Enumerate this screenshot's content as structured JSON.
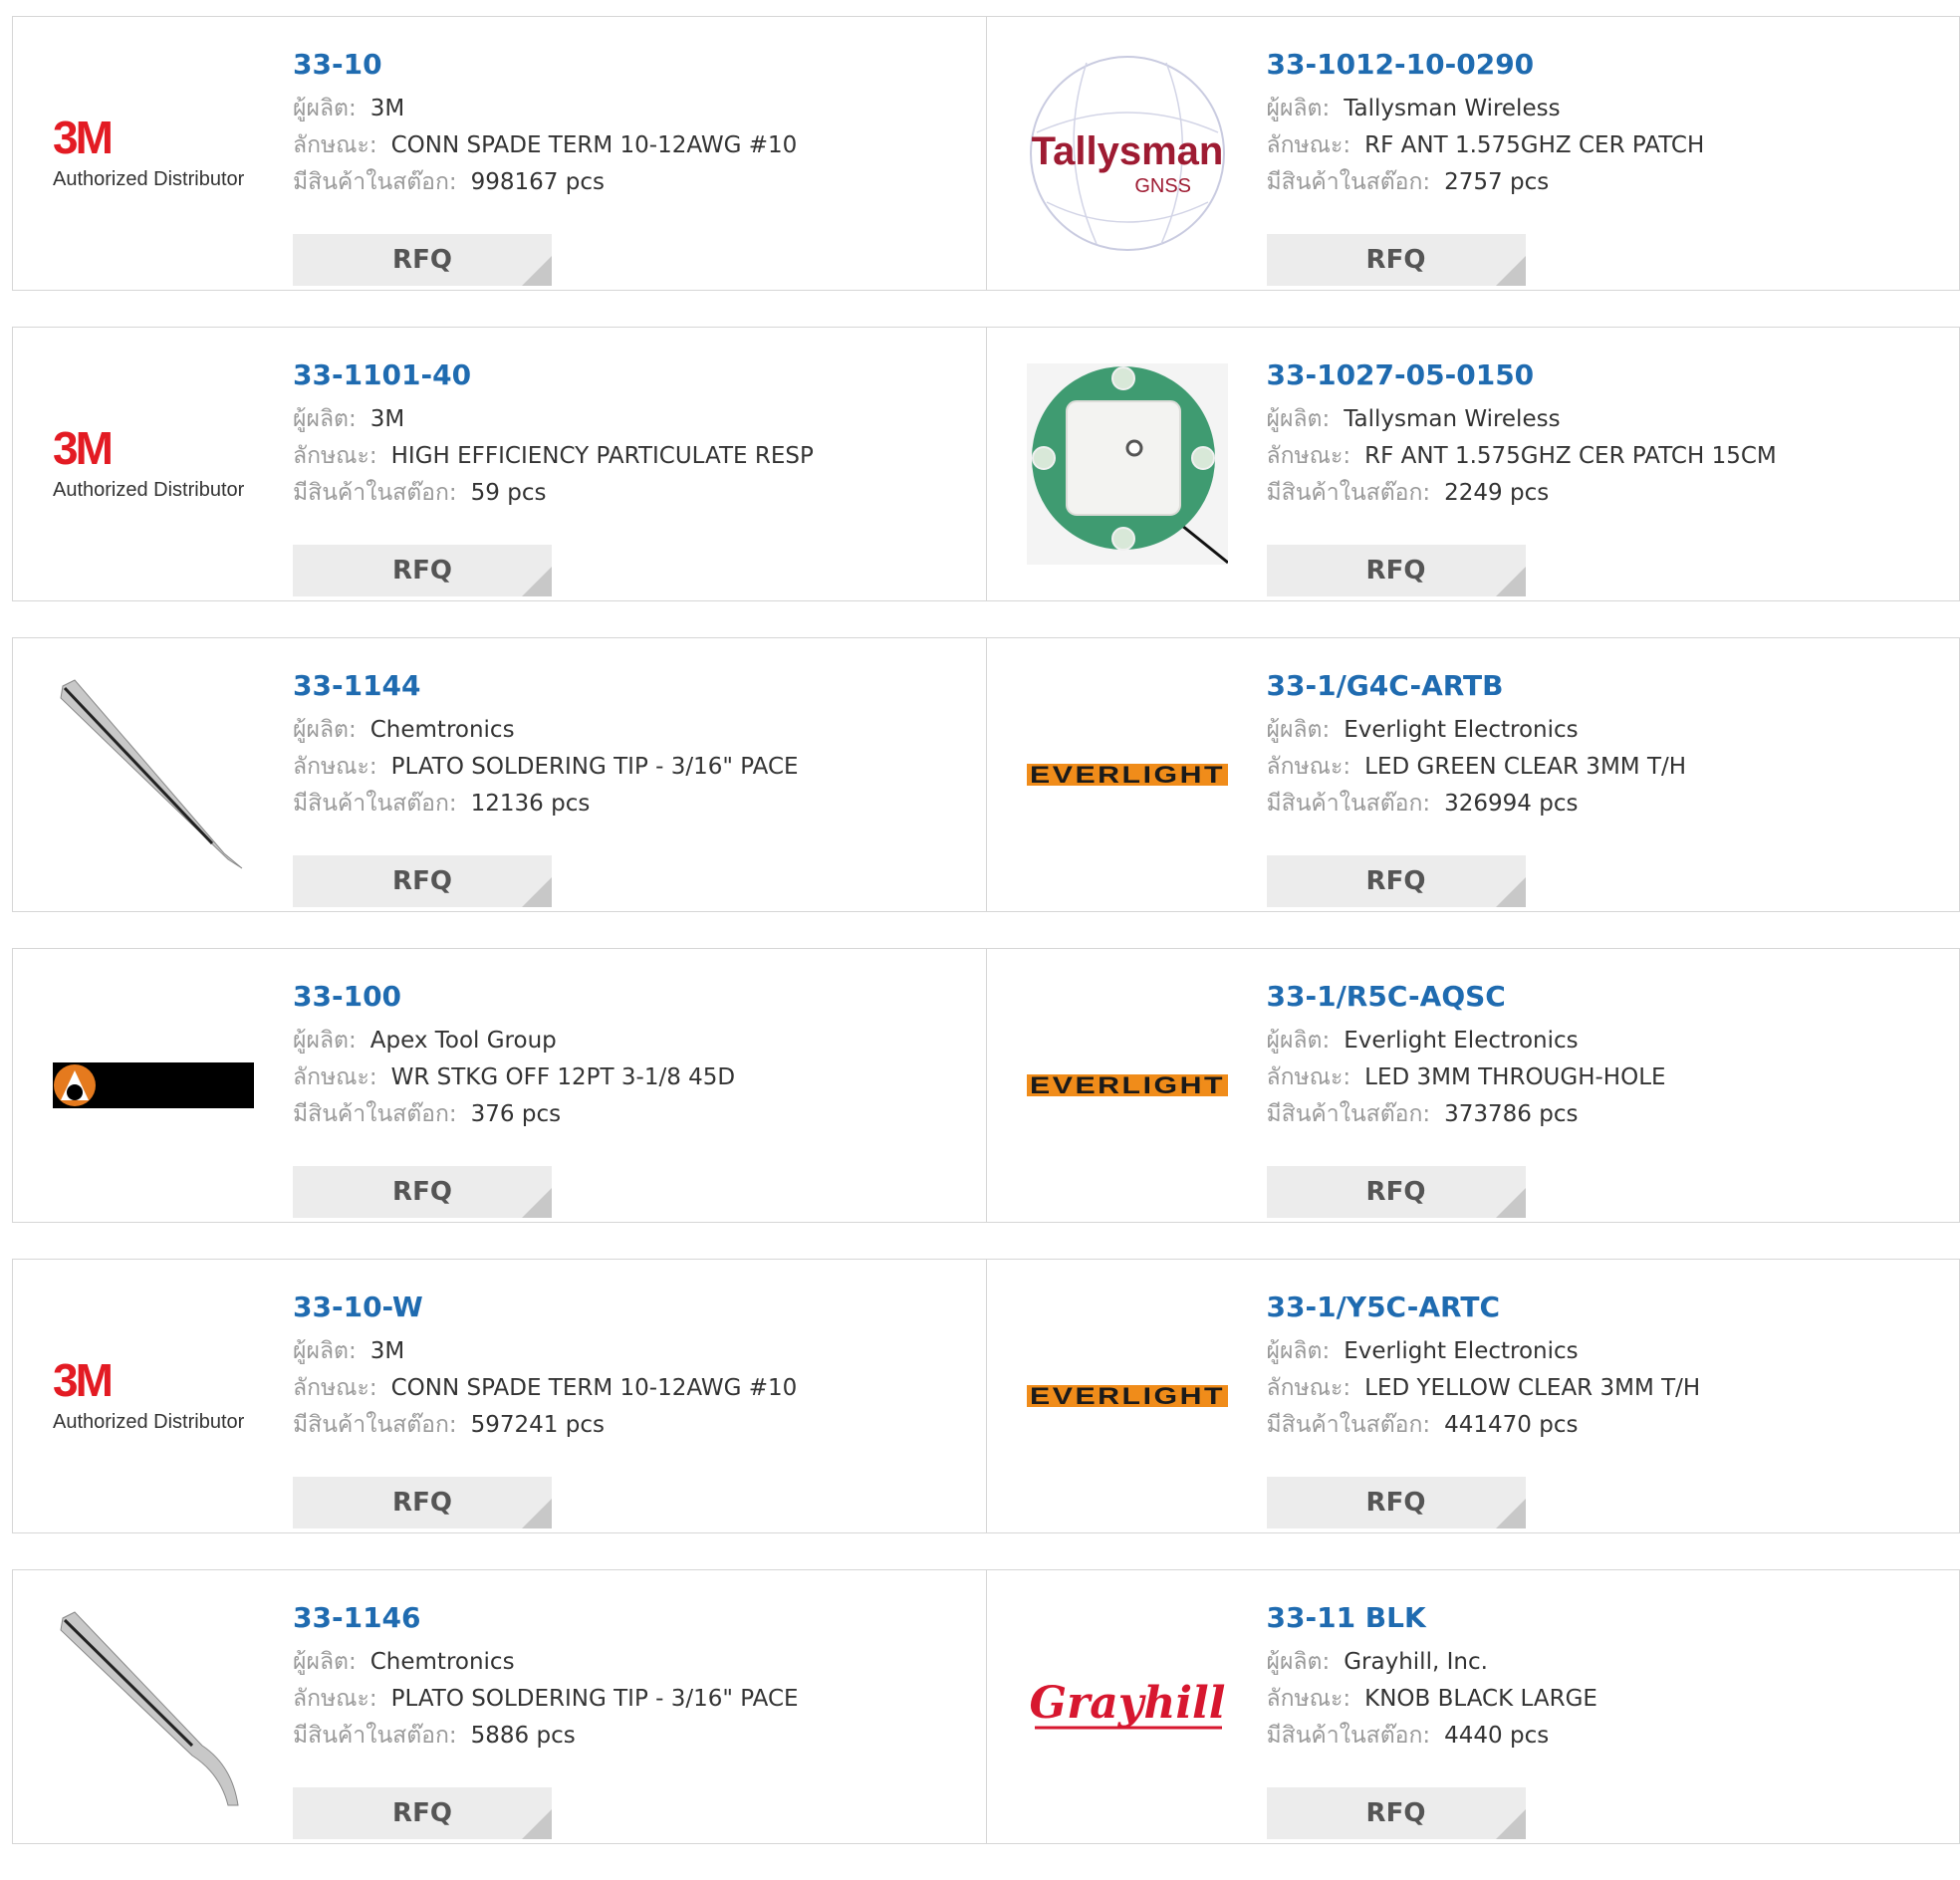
{
  "labels": {
    "manufacturer": "ผู้ผลิต:",
    "description": "ลักษณะ:",
    "stock": "มีสินค้าในสต๊อก:",
    "rfq": "RFQ"
  },
  "rows": [
    [
      {
        "part": "33-10",
        "manufacturer": "3M",
        "description": "CONN SPADE TERM 10-12AWG #10",
        "stock": "998167 pcs",
        "logo": "3m",
        "logo_caption": "Authorized Distributor"
      },
      {
        "part": "33-1012-10-0290",
        "manufacturer": "Tallysman Wireless",
        "description": "RF ANT 1.575GHZ CER PATCH",
        "stock": "2757 pcs",
        "logo": "tallysman"
      }
    ],
    [
      {
        "part": "33-1101-40",
        "manufacturer": "3M",
        "description": "HIGH EFFICIENCY PARTICULATE RESP",
        "stock": "59 pcs",
        "logo": "3m",
        "logo_caption": "Authorized Distributor"
      },
      {
        "part": "33-1027-05-0150",
        "manufacturer": "Tallysman Wireless",
        "description": "RF ANT 1.575GHZ CER PATCH 15CM",
        "stock": "2249 pcs",
        "logo": "antenna"
      }
    ],
    [
      {
        "part": "33-1144",
        "manufacturer": "Chemtronics",
        "description": "PLATO SOLDERING TIP - 3/16\" PACE",
        "stock": "12136 pcs",
        "logo": "tip-straight"
      },
      {
        "part": "33-1/G4C-ARTB",
        "manufacturer": "Everlight Electronics",
        "description": "LED GREEN CLEAR 3MM T/H",
        "stock": "326994 pcs",
        "logo": "everlight"
      }
    ],
    [
      {
        "part": "33-100",
        "manufacturer": "Apex Tool Group",
        "description": "WR STKG OFF 12PT 3-1/8 45D",
        "stock": "376 pcs",
        "logo": "apex"
      },
      {
        "part": "33-1/R5C-AQSC",
        "manufacturer": "Everlight Electronics",
        "description": "LED 3MM THROUGH-HOLE",
        "stock": "373786 pcs",
        "logo": "everlight"
      }
    ],
    [
      {
        "part": "33-10-W",
        "manufacturer": "3M",
        "description": "CONN SPADE TERM 10-12AWG #10",
        "stock": "597241 pcs",
        "logo": "3m",
        "logo_caption": "Authorized Distributor"
      },
      {
        "part": "33-1/Y5C-ARTC",
        "manufacturer": "Everlight Electronics",
        "description": "LED YELLOW CLEAR 3MM T/H",
        "stock": "441470 pcs",
        "logo": "everlight"
      }
    ],
    [
      {
        "part": "33-1146",
        "manufacturer": "Chemtronics",
        "description": "PLATO SOLDERING TIP - 3/16\" PACE",
        "stock": "5886 pcs",
        "logo": "tip-bent"
      },
      {
        "part": "33-11 BLK",
        "manufacturer": "Grayhill, Inc.",
        "description": "KNOB BLACK LARGE",
        "stock": "4440 pcs",
        "logo": "grayhill"
      }
    ]
  ],
  "colors": {
    "part_link": "#1f6bb0",
    "label": "#9a9a9a",
    "value": "#333333",
    "rfq_bg": "#ececec",
    "rfq_text": "#555555",
    "border": "#d6d6d6"
  }
}
